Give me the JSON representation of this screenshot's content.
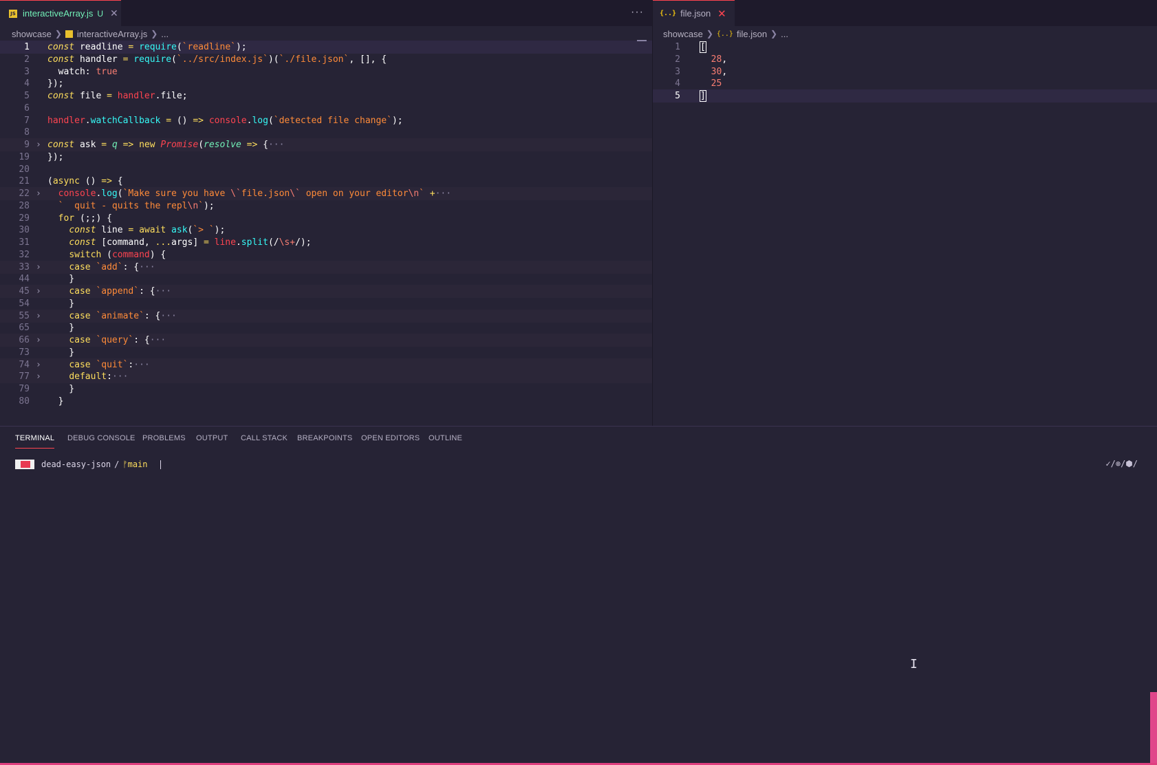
{
  "left_editor": {
    "tab": {
      "name": "interactiveArray.js",
      "status": "U",
      "icon": "JS"
    },
    "more_actions": "···",
    "breadcrumb": {
      "folder": "showcase",
      "file": "interactiveArray.js",
      "tail": "..."
    }
  },
  "right_editor": {
    "tab": {
      "name": "file.json",
      "icon": "{..}"
    },
    "breadcrumb": {
      "folder": "showcase",
      "file": "file.json",
      "tail": "..."
    }
  },
  "panel": {
    "tabs": [
      "TERMINAL",
      "DEBUG CONSOLE",
      "PROBLEMS",
      "OUTPUT",
      "CALL STACK",
      "BREAKPOINTS",
      "OPEN EDITORS",
      "OUTLINE"
    ],
    "active_tab": "TERMINAL"
  },
  "terminal": {
    "dir": "dead-easy-json",
    "slash": "/",
    "branch": "ᚠmain",
    "status_right": "✓/⊚/⬢/"
  },
  "left_code": [
    {
      "n": "1",
      "cur": true,
      "tok": [
        [
          "const",
          "kw"
        ],
        [
          " readline ",
          "v"
        ],
        [
          "=",
          "op"
        ],
        [
          " ",
          "v"
        ],
        [
          "require",
          "fn"
        ],
        [
          "(",
          "v"
        ],
        [
          "`readline`",
          "str"
        ],
        [
          ");",
          "v"
        ]
      ]
    },
    {
      "n": "2",
      "tok": [
        [
          "const",
          "kw"
        ],
        [
          " handler ",
          "v"
        ],
        [
          "=",
          "op"
        ],
        [
          " ",
          "v"
        ],
        [
          "require",
          "fn"
        ],
        [
          "(",
          "v"
        ],
        [
          "`../src/index.js`",
          "str"
        ],
        [
          ")(",
          "v"
        ],
        [
          "`./file.json`",
          "str"
        ],
        [
          ", [], {",
          "v"
        ]
      ]
    },
    {
      "n": "3",
      "tok": [
        [
          "  watch",
          "v"
        ],
        [
          ": ",
          "v"
        ],
        [
          "true",
          "num"
        ]
      ]
    },
    {
      "n": "4",
      "tok": [
        [
          "});",
          "v"
        ]
      ]
    },
    {
      "n": "5",
      "tok": [
        [
          "const",
          "kw"
        ],
        [
          " file ",
          "v"
        ],
        [
          "=",
          "op"
        ],
        [
          " ",
          "v"
        ],
        [
          "handler",
          "obj"
        ],
        [
          ".file;",
          "v"
        ]
      ]
    },
    {
      "n": "6",
      "tok": []
    },
    {
      "n": "7",
      "tok": [
        [
          "handler",
          "obj"
        ],
        [
          ".",
          "v"
        ],
        [
          "watchCallback",
          "fn"
        ],
        [
          " ",
          "v"
        ],
        [
          "=",
          "op"
        ],
        [
          " () ",
          "v"
        ],
        [
          "=>",
          "op"
        ],
        [
          " ",
          "v"
        ],
        [
          "console",
          "obj"
        ],
        [
          ".",
          "v"
        ],
        [
          "log",
          "fn"
        ],
        [
          "(",
          "v"
        ],
        [
          "`detected file change`",
          "str"
        ],
        [
          ");",
          "v"
        ]
      ]
    },
    {
      "n": "8",
      "tok": []
    },
    {
      "n": "9",
      "fold": true,
      "tok": [
        [
          "const",
          "kw"
        ],
        [
          " ask ",
          "v"
        ],
        [
          "=",
          "op"
        ],
        [
          " ",
          "v"
        ],
        [
          "q",
          "par"
        ],
        [
          " ",
          "v"
        ],
        [
          "=>",
          "op"
        ],
        [
          " ",
          "v"
        ],
        [
          "new",
          "kw2"
        ],
        [
          " ",
          "v"
        ],
        [
          "Promise",
          "cls"
        ],
        [
          "(",
          "v"
        ],
        [
          "resolve",
          "par"
        ],
        [
          " ",
          "v"
        ],
        [
          "=>",
          "op"
        ],
        [
          " {",
          "v"
        ],
        [
          "···",
          "fold"
        ]
      ]
    },
    {
      "n": "19",
      "tok": [
        [
          "});",
          "v"
        ]
      ]
    },
    {
      "n": "20",
      "tok": []
    },
    {
      "n": "21",
      "tok": [
        [
          "(",
          "v"
        ],
        [
          "async",
          "kw2"
        ],
        [
          " () ",
          "v"
        ],
        [
          "=>",
          "op"
        ],
        [
          " {",
          "v"
        ]
      ]
    },
    {
      "n": "22",
      "fold": true,
      "tok": [
        [
          "  ",
          "v"
        ],
        [
          "console",
          "obj"
        ],
        [
          ".",
          "v"
        ],
        [
          "log",
          "fn"
        ],
        [
          "(",
          "v"
        ],
        [
          "`Make sure you have ",
          "str"
        ],
        [
          "\\`",
          "esc"
        ],
        [
          "file.json",
          "str"
        ],
        [
          "\\`",
          "esc"
        ],
        [
          " open on your editor",
          "str"
        ],
        [
          "\\n",
          "esc"
        ],
        [
          "`",
          "str"
        ],
        [
          " ",
          "v"
        ],
        [
          "+",
          "op"
        ],
        [
          "···",
          "fold"
        ]
      ]
    },
    {
      "n": "28",
      "tok": [
        [
          "  ",
          "v"
        ],
        [
          "`  quit - quits the repl",
          "str"
        ],
        [
          "\\n",
          "esc"
        ],
        [
          "`",
          "str"
        ],
        [
          ");",
          "v"
        ]
      ]
    },
    {
      "n": "29",
      "tok": [
        [
          "  ",
          "v"
        ],
        [
          "for",
          "kw2"
        ],
        [
          " (;;) {",
          "v"
        ]
      ]
    },
    {
      "n": "30",
      "tok": [
        [
          "    ",
          "v"
        ],
        [
          "const",
          "kw"
        ],
        [
          " line ",
          "v"
        ],
        [
          "=",
          "op"
        ],
        [
          " ",
          "v"
        ],
        [
          "await",
          "kw2"
        ],
        [
          " ",
          "v"
        ],
        [
          "ask",
          "fn"
        ],
        [
          "(",
          "v"
        ],
        [
          "`> `",
          "str"
        ],
        [
          ");",
          "v"
        ]
      ]
    },
    {
      "n": "31",
      "tok": [
        [
          "    ",
          "v"
        ],
        [
          "const",
          "kw"
        ],
        [
          " [command, ",
          "v"
        ],
        [
          "...",
          "op"
        ],
        [
          "args] ",
          "v"
        ],
        [
          "=",
          "op"
        ],
        [
          " ",
          "v"
        ],
        [
          "line",
          "obj"
        ],
        [
          ".",
          "v"
        ],
        [
          "split",
          "fn"
        ],
        [
          "(/",
          "v"
        ],
        [
          "\\s+",
          "esc"
        ],
        [
          "/);",
          "v"
        ]
      ]
    },
    {
      "n": "32",
      "tok": [
        [
          "    ",
          "v"
        ],
        [
          "switch",
          "kw2"
        ],
        [
          " (",
          "v"
        ],
        [
          "command",
          "obj"
        ],
        [
          ") {",
          "v"
        ]
      ]
    },
    {
      "n": "33",
      "fold": true,
      "tok": [
        [
          "    ",
          "v"
        ],
        [
          "case",
          "kw2"
        ],
        [
          " ",
          "v"
        ],
        [
          "`add`",
          "str"
        ],
        [
          ": {",
          "v"
        ],
        [
          "···",
          "fold"
        ]
      ]
    },
    {
      "n": "44",
      "tok": [
        [
          "    }",
          "v"
        ]
      ]
    },
    {
      "n": "45",
      "fold": true,
      "tok": [
        [
          "    ",
          "v"
        ],
        [
          "case",
          "kw2"
        ],
        [
          " ",
          "v"
        ],
        [
          "`append`",
          "str"
        ],
        [
          ": {",
          "v"
        ],
        [
          "···",
          "fold"
        ]
      ]
    },
    {
      "n": "54",
      "tok": [
        [
          "    }",
          "v"
        ]
      ]
    },
    {
      "n": "55",
      "fold": true,
      "tok": [
        [
          "    ",
          "v"
        ],
        [
          "case",
          "kw2"
        ],
        [
          " ",
          "v"
        ],
        [
          "`animate`",
          "str"
        ],
        [
          ": {",
          "v"
        ],
        [
          "···",
          "fold"
        ]
      ]
    },
    {
      "n": "65",
      "tok": [
        [
          "    }",
          "v"
        ]
      ]
    },
    {
      "n": "66",
      "fold": true,
      "tok": [
        [
          "    ",
          "v"
        ],
        [
          "case",
          "kw2"
        ],
        [
          " ",
          "v"
        ],
        [
          "`query`",
          "str"
        ],
        [
          ": {",
          "v"
        ],
        [
          "···",
          "fold"
        ]
      ]
    },
    {
      "n": "73",
      "tok": [
        [
          "    }",
          "v"
        ]
      ]
    },
    {
      "n": "74",
      "fold": true,
      "tok": [
        [
          "    ",
          "v"
        ],
        [
          "case",
          "kw2"
        ],
        [
          " ",
          "v"
        ],
        [
          "`quit`",
          "str"
        ],
        [
          ":",
          "v"
        ],
        [
          "···",
          "fold"
        ]
      ]
    },
    {
      "n": "77",
      "fold": true,
      "tok": [
        [
          "    ",
          "v"
        ],
        [
          "default",
          "kw2"
        ],
        [
          ":",
          "v"
        ],
        [
          "···",
          "fold"
        ]
      ]
    },
    {
      "n": "79",
      "tok": [
        [
          "    }",
          "v"
        ]
      ]
    },
    {
      "n": "80",
      "tok": [
        [
          "  }",
          "v"
        ]
      ]
    }
  ],
  "right_code": [
    {
      "n": "1",
      "tok": [
        [
          "[",
          "cursor"
        ]
      ]
    },
    {
      "n": "2",
      "tok": [
        [
          "  ",
          "v"
        ],
        [
          "28",
          "num"
        ],
        [
          ",",
          "v"
        ]
      ]
    },
    {
      "n": "3",
      "tok": [
        [
          "  ",
          "v"
        ],
        [
          "30",
          "num"
        ],
        [
          ",",
          "v"
        ]
      ]
    },
    {
      "n": "4",
      "tok": [
        [
          "  ",
          "v"
        ],
        [
          "25",
          "num"
        ]
      ]
    },
    {
      "n": "5",
      "cur": true,
      "tok": [
        [
          "]",
          "cursor"
        ]
      ]
    }
  ]
}
